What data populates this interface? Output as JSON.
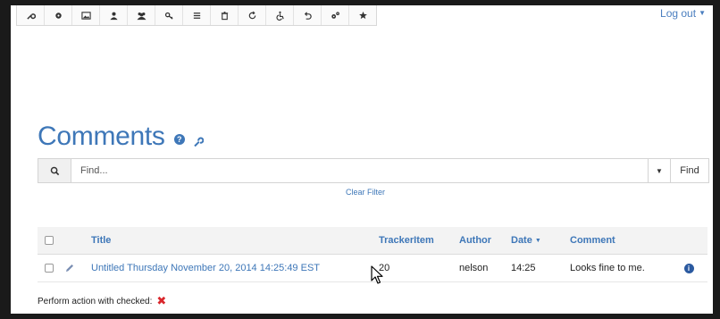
{
  "toolbar": {
    "buttons": [
      {
        "name": "wrench-icon"
      },
      {
        "name": "gear-icon"
      },
      {
        "name": "image-icon"
      },
      {
        "name": "user-icon"
      },
      {
        "name": "users-icon"
      },
      {
        "name": "key-icon"
      },
      {
        "name": "list-icon"
      },
      {
        "name": "trash-icon"
      },
      {
        "name": "refresh-icon"
      },
      {
        "name": "wheelchair-icon"
      },
      {
        "name": "undo-icon"
      },
      {
        "name": "cogs-icon"
      },
      {
        "name": "cog-badge-icon"
      }
    ]
  },
  "header": {
    "logout_label": "Log out"
  },
  "page": {
    "title": "Comments"
  },
  "search": {
    "placeholder": "Find...",
    "value": "",
    "button_label": "Find",
    "clear_filter_label": "Clear Filter"
  },
  "table": {
    "columns": {
      "title": "Title",
      "tracker_item": "TrackerItem",
      "author": "Author",
      "date": "Date",
      "comment": "Comment"
    },
    "rows": [
      {
        "title": "Untitled Thursday November 20, 2014 14:25:49 EST",
        "tracker_item": "20",
        "author": "nelson",
        "date": "14:25",
        "comment": "Looks fine to me."
      }
    ]
  },
  "bulk_action": {
    "label": "Perform action with checked:"
  },
  "colors": {
    "accent": "#3e77b8",
    "danger": "#d9262b"
  }
}
